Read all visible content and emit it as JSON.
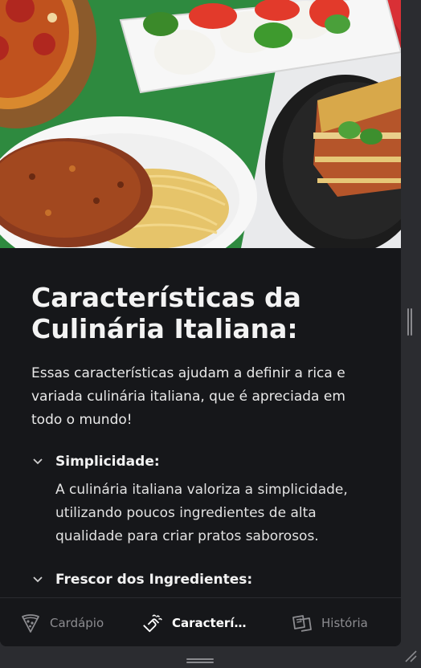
{
  "hero": {
    "image": "italian-food-photo"
  },
  "section": {
    "title": "Características da Culinária Italiana:",
    "intro": "Essas características ajudam a definir a rica e variada culinária italiana, que é apreciada em todo o mundo!",
    "items": [
      {
        "label": "Simplicidade:",
        "expanded": true,
        "body": "A culinária italiana valoriza a simplicidade, utilizando poucos ingredientes de alta qualidade para criar pratos saborosos."
      },
      {
        "label": "Frescor dos Ingredientes:",
        "expanded": true
      }
    ]
  },
  "tabs": [
    {
      "label": "Cardápio",
      "icon": "pizza-slice-icon",
      "active": false
    },
    {
      "label": "Características",
      "icon": "cooking-hand-icon",
      "active": true
    },
    {
      "label": "História",
      "icon": "history-book-icon",
      "active": false
    }
  ],
  "colors": {
    "background": "#16171a",
    "text": "#f3f3f3",
    "inactive_tab": "#8c8c90",
    "window_frame": "#2b2c30"
  }
}
